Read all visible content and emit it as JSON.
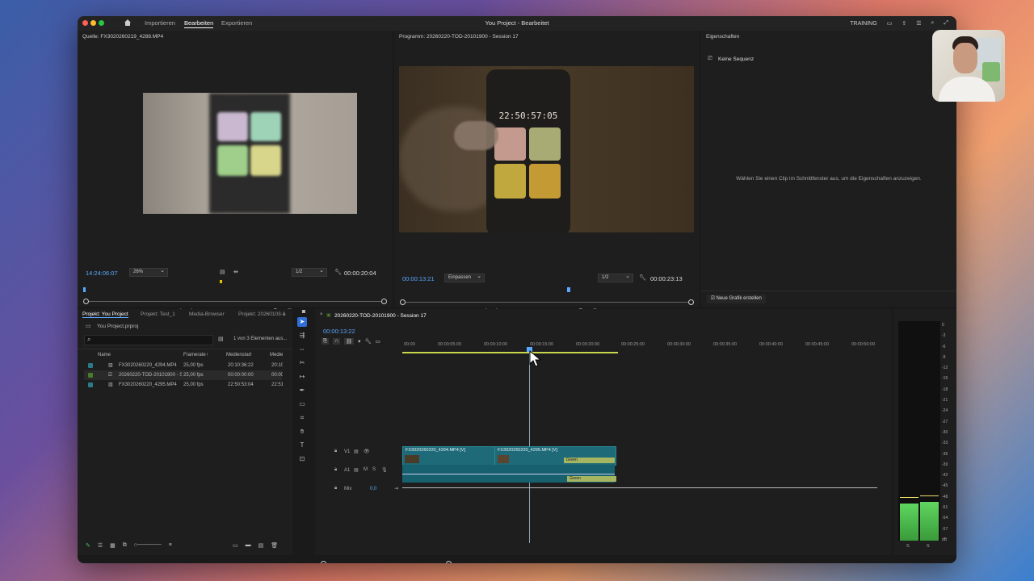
{
  "app": {
    "title": "You Project - Bearbeitet",
    "workspace_label": "TRAINING",
    "menu": [
      "Importieren",
      "Bearbeiten",
      "Exportieren"
    ],
    "active_menu": "Bearbeiten"
  },
  "source_monitor": {
    "title": "Quelle: FX3020260219_4288.MP4",
    "timecode": "14:24:06:07",
    "zoom": "26%",
    "resolution": "1/2",
    "duration": "00:00:20:04"
  },
  "program_monitor": {
    "title": "Programm: 20260220-TOD-20101900 - Session 17",
    "timecode": "00:00:13:21",
    "zoom": "Einpassen",
    "resolution": "1/2",
    "duration": "00:00:23:13",
    "phone_time": "22:50:57:05"
  },
  "properties": {
    "title": "Eigenschaften",
    "no_sequence": "Keine Sequenz",
    "hint": "Wählen Sie einen Clip im Schnittfenster aus, um die Eigenschaften anzuzeigen.",
    "new_graphic": "Neue Grafik erstellen"
  },
  "project": {
    "tabs": [
      "Projekt: You Project",
      "Projekt: Test_1",
      "Media-Browser",
      "Projekt: 20260103-1"
    ],
    "active_tab": "Projekt: You Project",
    "file": "You Project.prproj",
    "count": "1 von 3 Elementen aus...",
    "columns": [
      "Name",
      "Framerate",
      "Medienstart",
      "Medie"
    ],
    "items": [
      {
        "name": "FX3020260220_4294.MP4",
        "fps": "25,00 fps",
        "start": "20:10:36:22",
        "end": "20:10:",
        "color": "#2a7a8a"
      },
      {
        "name": "20260220-TOD-20101900 - S",
        "fps": "25,00 fps",
        "start": "00:00:00:00",
        "end": "00:00:",
        "color": "#4a7a2a"
      },
      {
        "name": "FX3020260220_4295.MP4",
        "fps": "25,00 fps",
        "start": "22:50:53:04",
        "end": "22:51:",
        "color": "#2a7a8a"
      }
    ]
  },
  "timeline": {
    "sequence": "20260220-TOD-20101900 - Session 17",
    "timecode": "00:00:13:22",
    "ruler": [
      "00:00",
      "00:00:05:00",
      "00:00:10:00",
      "00:00:15:00",
      "00:00:20:00",
      "00:00:25:00",
      "00:00:30:00",
      "00:00:35:00",
      "00:00:40:00",
      "00:00:45:00",
      "00:00:50:00"
    ],
    "tracks": {
      "v1": "V1",
      "a1": "A1",
      "mix": "Mix",
      "mix_value": "0,0"
    },
    "clips": [
      {
        "name": "FX3020260220_4294.MP4 [V]"
      },
      {
        "name": "FX3020260220_4295.MP4 [V]"
      }
    ],
    "effect_label": "Green"
  },
  "meter": {
    "scale": [
      "0",
      "-3",
      "-6",
      "-9",
      "-12",
      "-15",
      "-18",
      "-21",
      "-24",
      "-27",
      "-30",
      "-33",
      "-36",
      "-39",
      "-42",
      "-45",
      "-48",
      "-51",
      "-54",
      "-57",
      "dB"
    ],
    "channels": [
      "S",
      "S"
    ]
  }
}
